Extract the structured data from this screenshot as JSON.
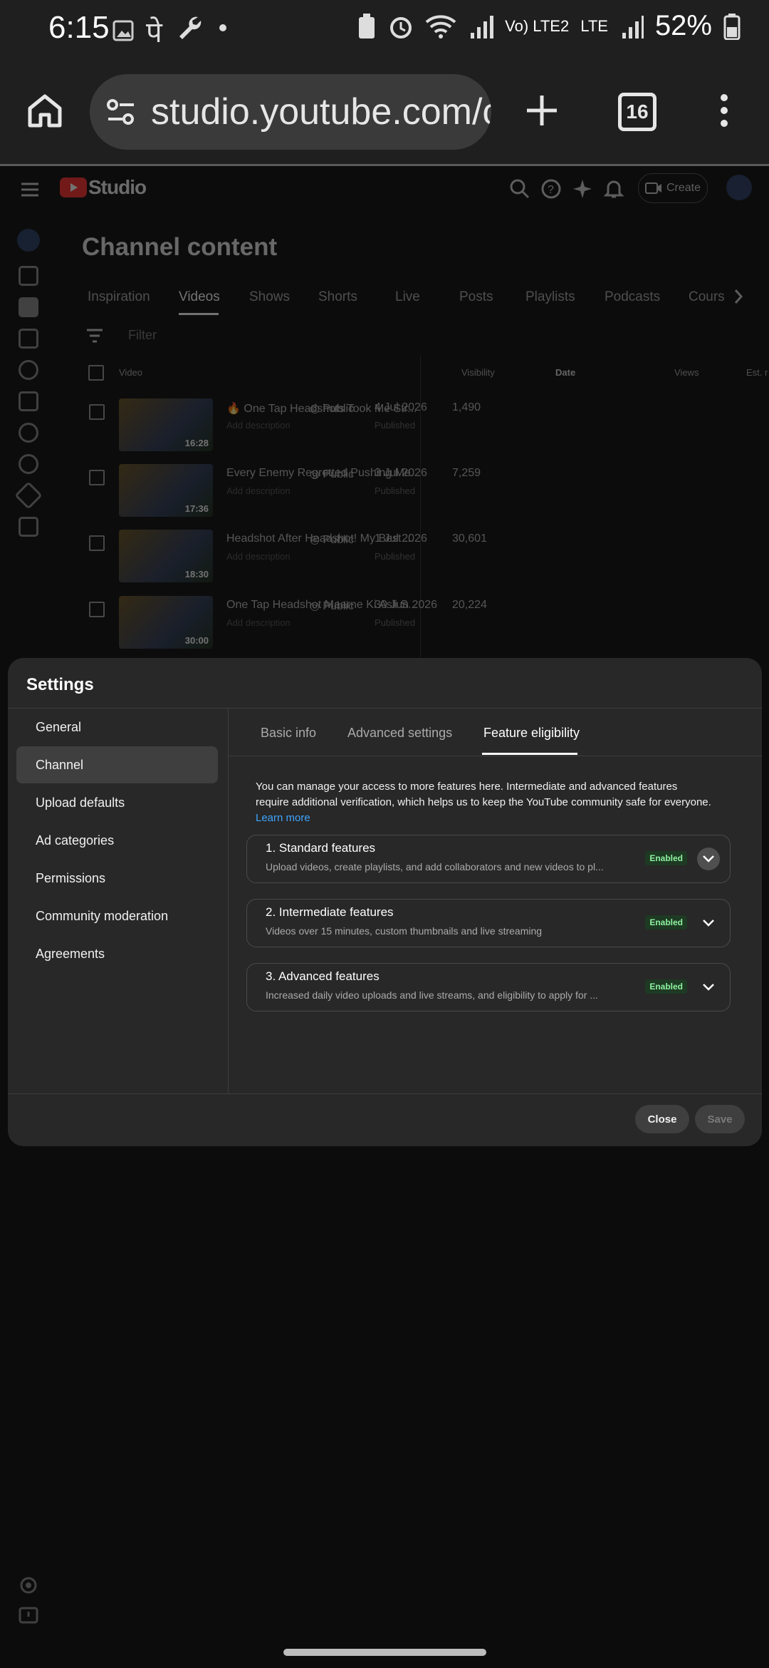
{
  "status_bar": {
    "time": "6:15",
    "network": "LTE",
    "volte": "Vo) LTE2",
    "battery": "52%"
  },
  "browser": {
    "url": "studio.youtube.com/ch",
    "tab_count": "16"
  },
  "studio": {
    "logo": "Studio",
    "create_label": "Create",
    "page_title": "Channel content",
    "tabs": [
      "Inspiration",
      "Videos",
      "Shows",
      "Shorts",
      "Live",
      "Posts",
      "Playlists",
      "Podcasts",
      "Cours"
    ],
    "filter_placeholder": "Filter",
    "columns": {
      "video": "Video",
      "visibility": "Visibility",
      "date": "Date",
      "views": "Views",
      "est": "Est. r"
    },
    "videos": [
      {
        "title": "🔥 One Tap Headshots Took Me Str...",
        "desc": "Add description",
        "duration": "16:28",
        "visibility": "Public",
        "date": "4 Jul 2026",
        "status": "Published",
        "views": "1,490"
      },
      {
        "title": "Every Enemy Regretted Pushing Me...",
        "desc": "Add description",
        "duration": "17:36",
        "visibility": "Public",
        "date": "3 Jul 2026",
        "status": "Published",
        "views": "7,259"
      },
      {
        "title": "Headshot After Headshot! My Best ...",
        "desc": "Add description",
        "duration": "18:30",
        "visibility": "Public",
        "date": "1 Jul 2026",
        "status": "Published",
        "views": "30,601"
      },
      {
        "title": "One Tap Headshot Maarne Ki Asli S...",
        "desc": "Add description",
        "duration": "30:00",
        "visibility": "Public",
        "date": "30 Jun 2026",
        "status": "Published",
        "views": "20,224"
      }
    ]
  },
  "settings": {
    "title": "Settings",
    "nav": [
      "General",
      "Channel",
      "Upload defaults",
      "Ad categories",
      "Permissions",
      "Community moderation",
      "Agreements"
    ],
    "tabs": [
      "Basic info",
      "Advanced settings",
      "Feature eligibility"
    ],
    "intro": "You can manage your access to more features here. Intermediate and advanced features require additional verification, which helps us to keep the YouTube community safe for everyone.",
    "learn_more": "Learn more",
    "features": [
      {
        "title": "1. Standard features",
        "desc": "Upload videos, create playlists, and add collaborators and new videos to pl...",
        "badge": "Enabled"
      },
      {
        "title": "2. Intermediate features",
        "desc": "Videos over 15 minutes, custom thumbnails and live streaming",
        "badge": "Enabled"
      },
      {
        "title": "3. Advanced features",
        "desc": "Increased daily video uploads and live streams, and eligibility to apply for ...",
        "badge": "Enabled"
      }
    ],
    "close_label": "Close",
    "save_label": "Save"
  }
}
